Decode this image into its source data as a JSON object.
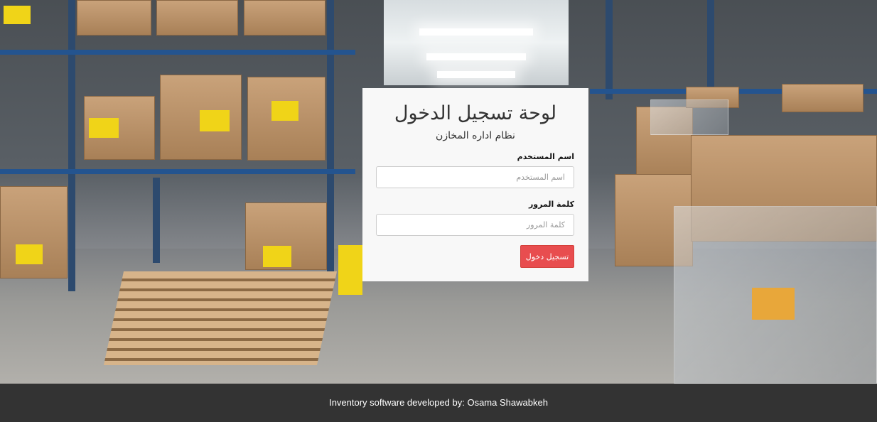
{
  "login": {
    "title": "لوحة تسجيل الدخول",
    "subtitle": "نظام اداره المخازن",
    "username_label": "اسم المستخدم",
    "username_placeholder": "اسم المستخدم",
    "username_value": "",
    "password_label": "كلمة المرور",
    "password_placeholder": "كلمة المرور",
    "password_value": "",
    "submit_label": "تسجيل دخول"
  },
  "footer": {
    "credit": "Inventory software developed by: Osama Shawabkeh"
  },
  "colors": {
    "panel_background": "#f8f8f8",
    "button_background": "#e84d4f",
    "footer_background": "#333333"
  }
}
